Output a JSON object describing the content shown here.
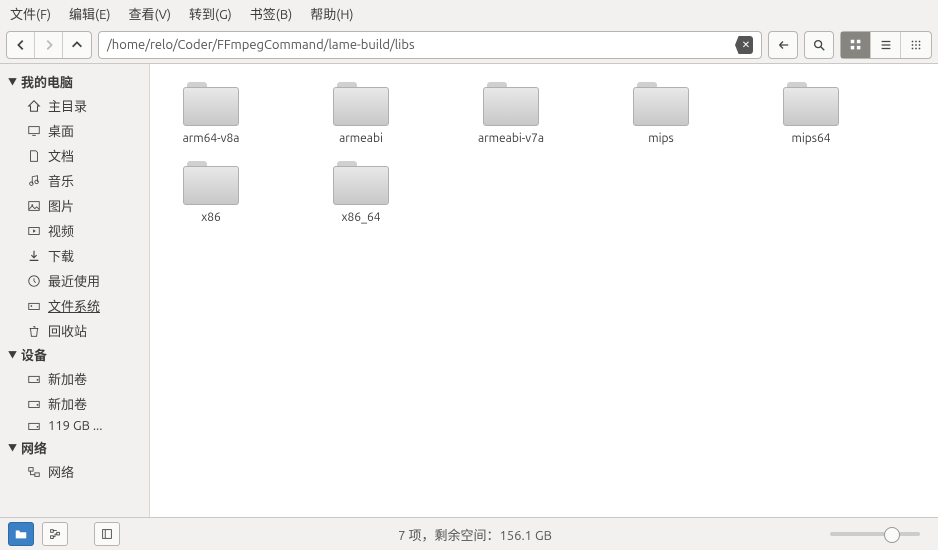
{
  "menu": [
    "文件(F)",
    "编辑(E)",
    "查看(V)",
    "转到(G)",
    "书签(B)",
    "帮助(H)"
  ],
  "path": "/home/relo/Coder/FFmpegCommand/lame-build/libs",
  "sidebar": {
    "sections": [
      {
        "title": "我的电脑",
        "items": [
          {
            "icon": "home",
            "label": "主目录"
          },
          {
            "icon": "desktop",
            "label": "桌面"
          },
          {
            "icon": "doc",
            "label": "文档"
          },
          {
            "icon": "music",
            "label": "音乐"
          },
          {
            "icon": "pic",
            "label": "图片"
          },
          {
            "icon": "video",
            "label": "视频"
          },
          {
            "icon": "download",
            "label": "下载"
          },
          {
            "icon": "recent",
            "label": "最近使用"
          },
          {
            "icon": "fs",
            "label": "文件系统",
            "sel": true
          },
          {
            "icon": "trash",
            "label": "回收站"
          }
        ]
      },
      {
        "title": "设备",
        "items": [
          {
            "icon": "drive",
            "label": "新加卷"
          },
          {
            "icon": "drive",
            "label": "新加卷"
          },
          {
            "icon": "drive",
            "label": "119 GB ..."
          }
        ]
      },
      {
        "title": "网络",
        "items": [
          {
            "icon": "net",
            "label": "网络"
          }
        ]
      }
    ]
  },
  "folders": [
    "arm64-v8a",
    "armeabi",
    "armeabi-v7a",
    "mips",
    "mips64",
    "x86",
    "x86_64"
  ],
  "status": "7 项，剩余空间：156.1 GB"
}
